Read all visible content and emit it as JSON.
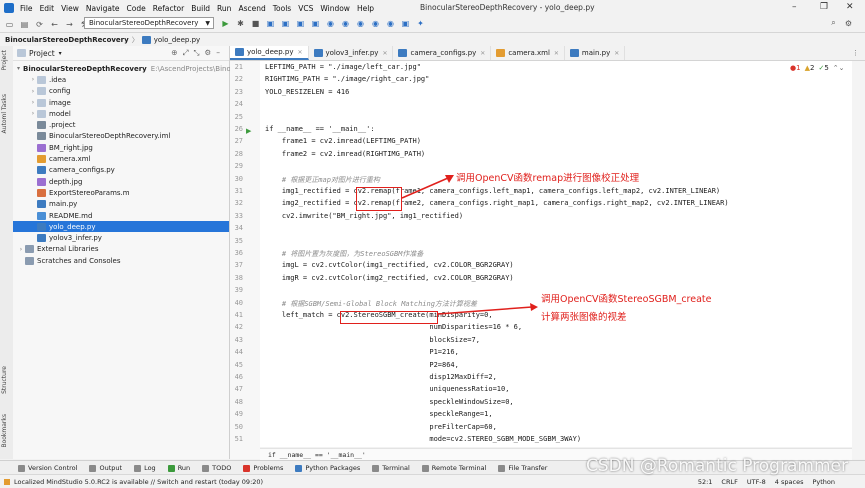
{
  "menu": [
    "File",
    "Edit",
    "View",
    "Navigate",
    "Code",
    "Refactor",
    "Build",
    "Run",
    "Ascend",
    "Tools",
    "VCS",
    "Window",
    "Help"
  ],
  "window_title": "BinocularStereoDepthRecovery - yolo_deep.py",
  "run_config": "BinocularStereoDepthRecovery",
  "breadcrumb": {
    "project": "BinocularStereoDepthRecovery",
    "sep": "〉",
    "file": "yolo_deep.py"
  },
  "side_tabs": {
    "project": "Project",
    "automl": "Automl Tasks",
    "structure": "Structure",
    "bookmarks": "Bookmarks"
  },
  "project_panel": {
    "title": "Project",
    "tree": [
      {
        "label": "BinocularStereoDepthRecovery",
        "extra": "E:\\AscendProjects\\Binoc",
        "type": "folder",
        "arrow": "▾",
        "indent": 0,
        "bold": true,
        "selected": false
      },
      {
        "label": ".idea",
        "extra": "",
        "type": "folder",
        "arrow": "›",
        "indent": 1,
        "bold": false,
        "selected": false
      },
      {
        "label": "config",
        "extra": "",
        "type": "folder",
        "arrow": "›",
        "indent": 1,
        "bold": false,
        "selected": false
      },
      {
        "label": "image",
        "extra": "",
        "type": "folder",
        "arrow": "›",
        "indent": 1,
        "bold": false,
        "selected": false
      },
      {
        "label": "model",
        "extra": "",
        "type": "folder",
        "arrow": "›",
        "indent": 1,
        "bold": false,
        "selected": false
      },
      {
        "label": ".project",
        "extra": "",
        "type": "imlfile",
        "arrow": "",
        "indent": 1,
        "bold": false,
        "selected": false
      },
      {
        "label": "BinocularStereoDepthRecovery.iml",
        "extra": "",
        "type": "imlfile",
        "arrow": "",
        "indent": 1,
        "bold": false,
        "selected": false
      },
      {
        "label": "BM_right.jpg",
        "extra": "",
        "type": "jpgfile",
        "arrow": "",
        "indent": 1,
        "bold": false,
        "selected": false
      },
      {
        "label": "camera.xml",
        "extra": "",
        "type": "xmlfile",
        "arrow": "",
        "indent": 1,
        "bold": false,
        "selected": false
      },
      {
        "label": "camera_configs.py",
        "extra": "",
        "type": "pyfile",
        "arrow": "",
        "indent": 1,
        "bold": false,
        "selected": false
      },
      {
        "label": "depth.jpg",
        "extra": "",
        "type": "jpgfile",
        "arrow": "",
        "indent": 1,
        "bold": false,
        "selected": false
      },
      {
        "label": "ExportStereoParams.m",
        "extra": "",
        "type": "mfile",
        "arrow": "",
        "indent": 1,
        "bold": false,
        "selected": false
      },
      {
        "label": "main.py",
        "extra": "",
        "type": "pyfile",
        "arrow": "",
        "indent": 1,
        "bold": false,
        "selected": false
      },
      {
        "label": "README.md",
        "extra": "",
        "type": "mdfile",
        "arrow": "",
        "indent": 1,
        "bold": false,
        "selected": false
      },
      {
        "label": "yolo_deep.py",
        "extra": "",
        "type": "pyfile",
        "arrow": "",
        "indent": 1,
        "bold": false,
        "selected": true
      },
      {
        "label": "yolov3_infer.py",
        "extra": "",
        "type": "pyfile",
        "arrow": "",
        "indent": 1,
        "bold": false,
        "selected": false
      },
      {
        "label": "External Libraries",
        "extra": "",
        "type": "libicon",
        "arrow": "›",
        "indent": 0,
        "bold": false,
        "selected": false
      },
      {
        "label": "Scratches and Consoles",
        "extra": "",
        "type": "libicon",
        "arrow": "",
        "indent": 0,
        "bold": false,
        "selected": false
      }
    ]
  },
  "editor_tabs": [
    {
      "label": "yolo_deep.py",
      "active": true
    },
    {
      "label": "yolov3_infer.py",
      "active": false
    },
    {
      "label": "camera_configs.py",
      "active": false
    },
    {
      "label": "camera.xml",
      "active": false
    },
    {
      "label": "main.py",
      "active": false
    }
  ],
  "inspections": {
    "errors": "1",
    "warnings": "2",
    "weak": "5"
  },
  "code_lines": [
    {
      "n": "21",
      "text": "LEFTIMG_PATH = \"./image/left_car.jpg\"",
      "cm": false
    },
    {
      "n": "22",
      "text": "RIGHTIMG_PATH = \"./image/right_car.jpg\"",
      "cm": false
    },
    {
      "n": "23",
      "text": "YOLO_RESIZELEN = 416",
      "cm": false
    },
    {
      "n": "24",
      "text": "",
      "cm": false
    },
    {
      "n": "25",
      "text": "",
      "cm": false
    },
    {
      "n": "26",
      "text": "if __name__ == '__main__':",
      "cm": false
    },
    {
      "n": "27",
      "text": "    frame1 = cv2.imread(LEFTIMG_PATH)",
      "cm": false
    },
    {
      "n": "28",
      "text": "    frame2 = cv2.imread(RIGHTIMG_PATH)",
      "cm": false
    },
    {
      "n": "29",
      "text": "",
      "cm": false
    },
    {
      "n": "30",
      "text": "    # 根据更正map对图片进行重构",
      "cm": true
    },
    {
      "n": "31",
      "text": "    img1_rectified = cv2.remap(frame1, camera_configs.left_map1, camera_configs.left_map2, cv2.INTER_LINEAR)",
      "cm": false
    },
    {
      "n": "32",
      "text": "    img2_rectified = cv2.remap(frame2, camera_configs.right_map1, camera_configs.right_map2, cv2.INTER_LINEAR)",
      "cm": false
    },
    {
      "n": "33",
      "text": "    cv2.imwrite(\"BM_right.jpg\", img1_rectified)",
      "cm": false
    },
    {
      "n": "34",
      "text": "",
      "cm": false
    },
    {
      "n": "35",
      "text": "",
      "cm": false
    },
    {
      "n": "36",
      "text": "    # 将图片置为灰度图，为StereoSGBM作准备",
      "cm": true
    },
    {
      "n": "37",
      "text": "    imgL = cv2.cvtColor(img1_rectified, cv2.COLOR_BGR2GRAY)",
      "cm": false
    },
    {
      "n": "38",
      "text": "    imgR = cv2.cvtColor(img2_rectified, cv2.COLOR_BGR2GRAY)",
      "cm": false
    },
    {
      "n": "39",
      "text": "",
      "cm": false
    },
    {
      "n": "40",
      "text": "    # 根据SGBM/Semi-Global Block Matching方法计算视差",
      "cm": true
    },
    {
      "n": "41",
      "text": "    left_match = cv2.StereoSGBM_create(minDisparity=0,",
      "cm": false
    },
    {
      "n": "42",
      "text": "                                       numDisparities=16 * 6,",
      "cm": false
    },
    {
      "n": "43",
      "text": "                                       blockSize=7,",
      "cm": false
    },
    {
      "n": "44",
      "text": "                                       P1=216,",
      "cm": false
    },
    {
      "n": "45",
      "text": "                                       P2=864,",
      "cm": false
    },
    {
      "n": "46",
      "text": "                                       disp12MaxDiff=2,",
      "cm": false
    },
    {
      "n": "47",
      "text": "                                       uniquenessRatio=10,",
      "cm": false
    },
    {
      "n": "48",
      "text": "                                       speckleWindowSize=0,",
      "cm": false
    },
    {
      "n": "49",
      "text": "                                       speckleRange=1,",
      "cm": false
    },
    {
      "n": "50",
      "text": "                                       preFilterCap=60,",
      "cm": false
    },
    {
      "n": "51",
      "text": "                                       mode=cv2.STEREO_SGBM_MODE_SGBM_3WAY)",
      "cm": false
    }
  ],
  "annotations": {
    "remap": "调用OpenCV函数remap进行图像校正处理",
    "sgbm_line1": "调用OpenCV函数StereoSGBM_create",
    "sgbm_line2": "计算两张图像的视差"
  },
  "function_breadcrumb": "if __name__ == '__main__'",
  "tool_windows": [
    "Version Control",
    "Output",
    "Log",
    "Run",
    "TODO",
    "Problems",
    "Python Packages",
    "Terminal",
    "Remote Terminal",
    "File Transfer"
  ],
  "status": {
    "message": "Localized MindStudio 5.0.RC2 is available // Switch and restart (today 09:20)",
    "position": "52:1",
    "line_sep": "CRLF",
    "encoding": "UTF-8",
    "indent": "4 spaces",
    "interpreter": "Python"
  },
  "watermark": "CSDN @Romantic Programmer",
  "colors": {
    "accent": "#2675d9",
    "annotation_red": "#e0201c",
    "selection": "#2675d9"
  }
}
